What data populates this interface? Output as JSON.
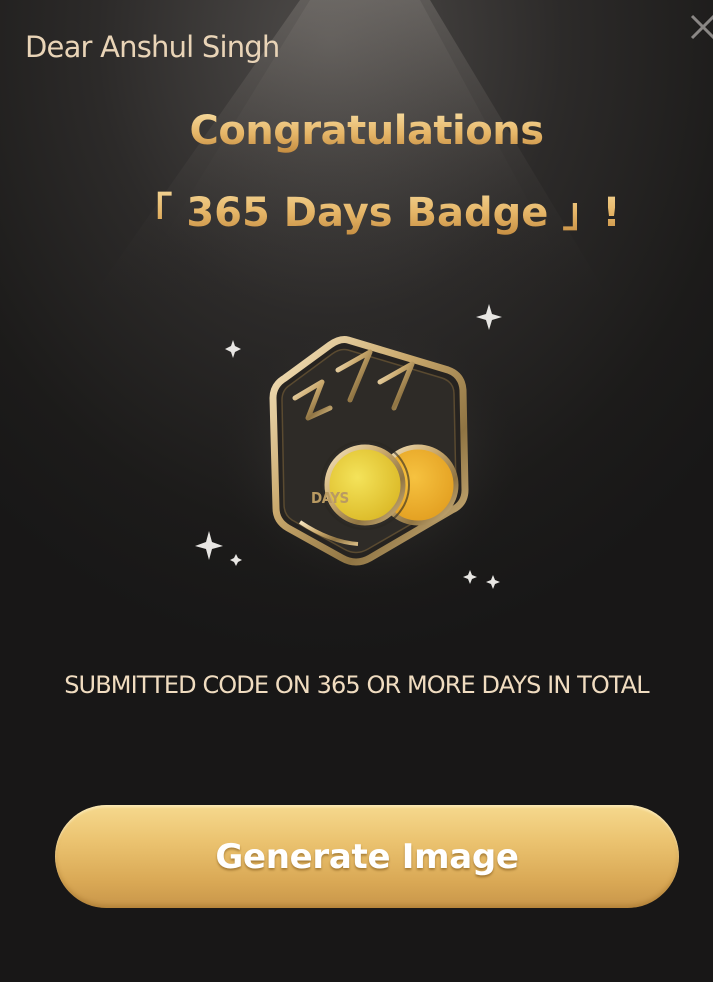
{
  "dialog": {
    "greeting": "Dear Anshul Singh",
    "title_line1": "Congratulations",
    "title_line2": "「 365 Days Badge 」!",
    "description": "SUBMITTED CODE ON 365 OR MORE DAYS IN TOTAL",
    "generate_button_label": "Generate Image",
    "close_icon": "close-icon"
  },
  "badge": {
    "icon": "365-days-badge-icon",
    "number_text": "365",
    "days_text": "DAYS",
    "sparkle_icon": "sparkle-icon"
  },
  "colors": {
    "background": "#1a1918",
    "gold_light": "#f8e0a6",
    "gold_dark": "#c38a3e",
    "text_cream": "#f0dcc0",
    "button_gold": "#ebc370",
    "badge_yellow": "#e6c631",
    "badge_orange": "#e8a624"
  }
}
